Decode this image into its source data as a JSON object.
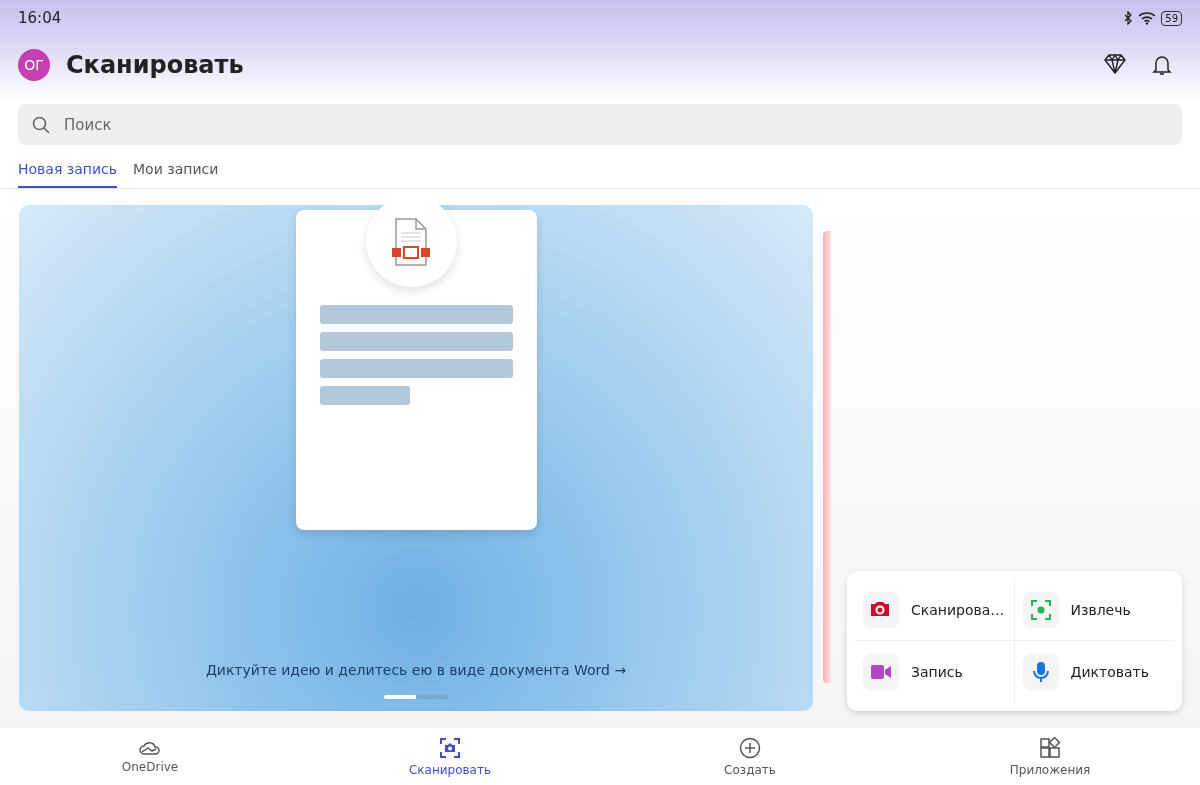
{
  "status_bar": {
    "time": "16:04",
    "battery": "59"
  },
  "header": {
    "avatar": "ОГ",
    "title": "Сканировать"
  },
  "search": {
    "placeholder": "Поиск"
  },
  "tabs": [
    {
      "label": "Новая запись",
      "selected": true
    },
    {
      "label": "Мои записи",
      "selected": false
    }
  ],
  "banner": {
    "caption": "Диктуйте идею и делитесь ею в виде документа Word",
    "arrow": "→",
    "pages": [
      {
        "selected": true
      },
      {
        "selected": false
      }
    ]
  },
  "quick_actions": [
    {
      "kind": "camera",
      "label": "Сканирова…",
      "color": "#c8102e"
    },
    {
      "kind": "extract",
      "label": "Извлечь",
      "color": "#1db954"
    },
    {
      "kind": "video",
      "label": "Запись",
      "color": "#b146c2"
    },
    {
      "kind": "mic",
      "label": "Диктовать",
      "color": "#1a73d9"
    }
  ],
  "bottom_nav": [
    {
      "kind": "cloud",
      "label": "OneDrive",
      "selected": false
    },
    {
      "kind": "scan",
      "label": "Сканировать",
      "selected": true
    },
    {
      "kind": "plus",
      "label": "Создать",
      "selected": false
    },
    {
      "kind": "apps",
      "label": "Приложения",
      "selected": false
    }
  ]
}
